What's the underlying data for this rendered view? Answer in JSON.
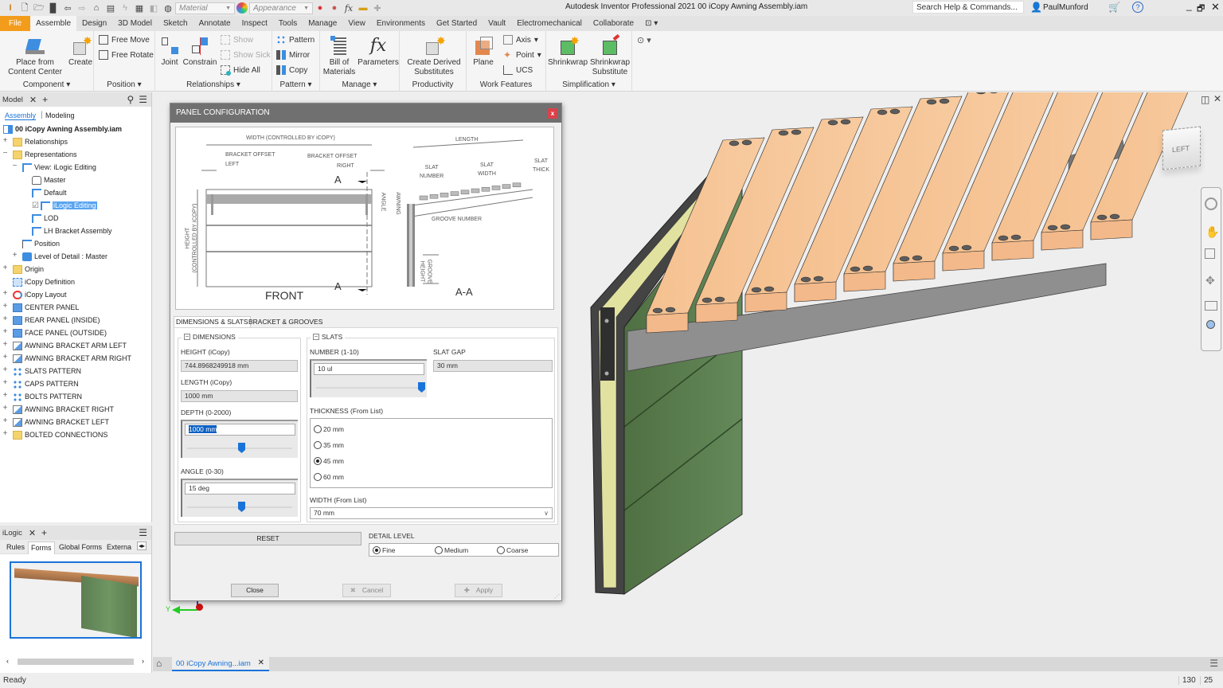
{
  "quick_access": {
    "material_placeholder": "Material",
    "appearance_placeholder": "Appearance",
    "fx": "fx"
  },
  "window": {
    "title": "Autodesk Inventor Professional 2021    00 iCopy Awning Assembly.iam",
    "search_placeholder": "Search Help & Commands...",
    "user": "PaulMunford"
  },
  "ribbon_tabs": [
    "File",
    "Assemble",
    "Design",
    "3D Model",
    "Sketch",
    "Annotate",
    "Inspect",
    "Tools",
    "Manage",
    "View",
    "Environments",
    "Get Started",
    "Vault",
    "Electromechanical",
    "Collaborate"
  ],
  "active_tab": "Assemble",
  "ribbon": {
    "component": {
      "label": "Component",
      "place": "Place from\nContent Center",
      "create": "Create"
    },
    "position": {
      "label": "Position",
      "free_move": "Free Move",
      "free_rotate": "Free Rotate"
    },
    "relationships": {
      "label": "Relationships",
      "joint": "Joint",
      "constrain": "Constrain",
      "show": "Show",
      "show_sick": "Show Sick",
      "hide_all": "Hide All"
    },
    "pattern": {
      "label": "Pattern",
      "pattern": "Pattern",
      "mirror": "Mirror",
      "copy": "Copy"
    },
    "manage": {
      "label": "Manage",
      "bom": "Bill of\nMaterials",
      "parameters": "Parameters"
    },
    "productivity": {
      "label": "Productivity",
      "derived": "Create Derived\nSubstitutes"
    },
    "work_features": {
      "label": "Work Features",
      "plane": "Plane",
      "axis": "Axis",
      "point": "Point",
      "ucs": "UCS"
    },
    "simplification": {
      "label": "Simplification",
      "shrinkwrap": "Shrinkwrap",
      "shrinkwrap_sub": "Shrinkwrap\nSubstitute"
    }
  },
  "browser": {
    "tab": "Model",
    "subtabs": [
      "Assembly",
      "Modeling"
    ],
    "root": "00 iCopy Awning Assembly.iam",
    "items": [
      {
        "label": "Relationships",
        "icon": "folder-icon",
        "level": 1,
        "exp": "+"
      },
      {
        "label": "Representations",
        "icon": "representations-icon",
        "level": 1,
        "exp": "−"
      },
      {
        "label": "View: iLogic Editing",
        "icon": "view-rep-icon",
        "level": 2,
        "exp": "−"
      },
      {
        "label": "Master",
        "icon": "lock-icon",
        "level": 3,
        "exp": ""
      },
      {
        "label": "Default",
        "icon": "view-rep-icon",
        "level": 3,
        "exp": ""
      },
      {
        "label": "iLogic Editing",
        "icon": "view-rep-icon",
        "level": 3,
        "exp": "",
        "checked": true,
        "selected": true
      },
      {
        "label": "LOD",
        "icon": "view-rep-icon",
        "level": 3,
        "exp": ""
      },
      {
        "label": "LH Bracket Assembly",
        "icon": "view-rep-icon",
        "level": 3,
        "exp": ""
      },
      {
        "label": "Position",
        "icon": "position-rep-icon",
        "level": 2,
        "exp": ""
      },
      {
        "label": "Level of Detail : Master",
        "icon": "lod-icon",
        "level": 2,
        "exp": "+"
      },
      {
        "label": "Origin",
        "icon": "folder-icon",
        "level": 1,
        "exp": "+"
      },
      {
        "label": "iCopy Definition",
        "icon": "icopy-definition-icon",
        "level": 1,
        "exp": ""
      },
      {
        "label": "iCopy Layout",
        "icon": "icopy-layout-icon",
        "level": 1,
        "exp": "+"
      },
      {
        "label": "CENTER PANEL",
        "icon": "part-icon",
        "level": 1,
        "exp": "+"
      },
      {
        "label": "REAR PANEL (INSIDE)",
        "icon": "part-icon",
        "level": 1,
        "exp": "+"
      },
      {
        "label": "FACE PANEL (OUTSIDE)",
        "icon": "part-icon",
        "level": 1,
        "exp": "+"
      },
      {
        "label": "AWNING BRACKET ARM LEFT",
        "icon": "subassembly-icon",
        "level": 1,
        "exp": "+"
      },
      {
        "label": "AWNING BRACKET ARM RIGHT",
        "icon": "subassembly-icon",
        "level": 1,
        "exp": "+"
      },
      {
        "label": "SLATS PATTERN",
        "icon": "pattern-icon",
        "level": 1,
        "exp": "+"
      },
      {
        "label": "CAPS PATTERN",
        "icon": "pattern-icon",
        "level": 1,
        "exp": "+"
      },
      {
        "label": "BOLTS PATTERN",
        "icon": "pattern-icon",
        "level": 1,
        "exp": "+"
      },
      {
        "label": "AWNING BRACKET RIGHT",
        "icon": "subassembly-icon",
        "level": 1,
        "exp": "+"
      },
      {
        "label": "AWNING BRACKET LEFT",
        "icon": "subassembly-icon",
        "level": 1,
        "exp": "+"
      },
      {
        "label": "BOLTED CONNECTIONS",
        "icon": "folder-icon",
        "level": 1,
        "exp": "+"
      }
    ]
  },
  "ilogic": {
    "tab": "iLogic",
    "subtabs": [
      "Rules",
      "Forms",
      "Global Forms",
      "Externa"
    ],
    "active_subtab": "Forms"
  },
  "dialog": {
    "title": "PANEL CONFIGURATION",
    "close_x": "x",
    "drawing": {
      "width": "WIDTH (CONTROLLED BY iCOPY)",
      "bracket_left_1": "BRACKET OFFSET",
      "bracket_left_2": "LEFT",
      "bracket_right_1": "BRACKET OFFSET",
      "bracket_right_2": "RIGHT",
      "height": "HEIGHT\n(CONTROLLED BY iCOPY)",
      "angle": "ANGLE",
      "awning": "AWNING",
      "section_a": "A",
      "front": "FRONT",
      "section_aa": "A-A",
      "length": "LENGTH",
      "slat_number": "SLAT\nNUMBER",
      "slat_width": "SLAT\nWIDTH",
      "slat_thick": "SLAT\nTHICK",
      "groove_number": "GROOVE NUMBER",
      "groove_height": "GROOVE\nHEIGHT"
    },
    "tabs": [
      "DIMENSIONS & SLATS",
      "BRACKET & GROOVES"
    ],
    "active_tab": "DIMENSIONS & SLATS",
    "dimensions": {
      "legend": "DIMENSIONS",
      "height_label": "HEIGHT (iCopy)",
      "height_value": "744.8968249918 mm",
      "length_label": "LENGTH (iCopy)",
      "length_value": "1000 mm",
      "depth_label": "DEPTH (0-2000)",
      "depth_value": "1000 mm",
      "depth_slider": 0.5,
      "angle_label": "ANGLE (0-30)",
      "angle_value": "15 deg",
      "angle_slider": 0.5
    },
    "slats": {
      "legend": "SLATS",
      "number_label": "NUMBER (1-10)",
      "number_value": "10 ul",
      "number_slider": 1.0,
      "gap_label": "SLAT GAP",
      "gap_value": "30 mm",
      "thickness_label": "THICKNESS (From List)",
      "thickness_options": [
        "20 mm",
        "35 mm",
        "45 mm",
        "60 mm"
      ],
      "thickness_selected": "45 mm",
      "width_label": "WIDTH (From List)",
      "width_value": "70 mm"
    },
    "reset": "RESET",
    "detail_label": "DETAIL LEVEL",
    "detail_options": [
      "Fine",
      "Medium",
      "Coarse"
    ],
    "detail_selected": "Fine",
    "close_btn": "Close",
    "cancel_btn": "Cancel",
    "apply_btn": "Apply"
  },
  "viewcube": {
    "face": "LEFT"
  },
  "axis_triad": {
    "y": "Y"
  },
  "document_tab": "00 iCopy Awning...iam",
  "status": {
    "text": "Ready",
    "count1": "130",
    "count2": "25"
  },
  "model": {
    "slat_count": 10
  }
}
